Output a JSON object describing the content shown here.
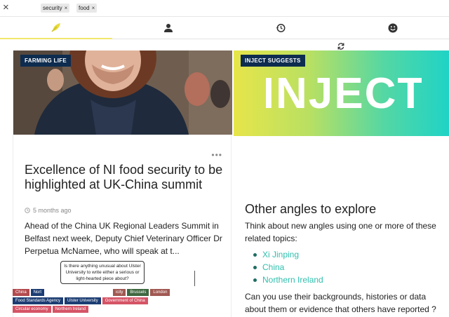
{
  "filters": {
    "close_label": "×",
    "chips": [
      {
        "label": "security",
        "remove": "×"
      },
      {
        "label": "food",
        "remove": "×"
      }
    ]
  },
  "tabs": [
    {
      "icon": "leaf-icon",
      "active": true
    },
    {
      "icon": "person-icon",
      "active": false
    },
    {
      "icon": "history-icon",
      "active": false
    },
    {
      "icon": "smiley-icon",
      "active": false
    }
  ],
  "colors": {
    "accent_yellow": "#f2e66e",
    "badge_navy": "#0d2c4f",
    "topic_teal": "#2fbfae"
  },
  "article": {
    "badge": "FARMING LIFE",
    "more_label": "•••",
    "headline": "Excellence of NI food security to be highlighted at UK-China summit",
    "time": "5 months ago",
    "summary": "Ahead of the China UK Regional Leaders Summit in Belfast next week, Deputy Chief Veterinary Officer Dr Perpetua McNamee, who will speak at t...",
    "tooltip": "Is there anything unusual about Ulster University to write either a serious or light-hearted piece about?",
    "tags_row1": [
      {
        "label": "China",
        "color": "red"
      },
      {
        "label": "Nort",
        "color": "navy"
      },
      {
        "label": "icity",
        "color": "brown"
      },
      {
        "label": "Brussels",
        "color": "green"
      },
      {
        "label": "London",
        "color": "brown"
      }
    ],
    "tags_row2": [
      {
        "label": "Food Standards Agency",
        "color": "navy"
      },
      {
        "label": "Ulster University",
        "color": "navy"
      },
      {
        "label": "Government of China",
        "color": "pink"
      }
    ],
    "tags_row3": [
      {
        "label": "Circular economy",
        "color": "pink"
      },
      {
        "label": "Northern Ireland",
        "color": "pink"
      }
    ]
  },
  "suggest": {
    "badge": "INJECT SUGGESTS",
    "logo_text": "INJECT",
    "title": "Other angles to explore",
    "intro": "Think about new angles using one or more of these related topics:",
    "topics": [
      "Xi Jinping",
      "China",
      "Northern Ireland"
    ],
    "question": "Can you use their backgrounds, histories or data about them or evidence that others have reported ?"
  }
}
